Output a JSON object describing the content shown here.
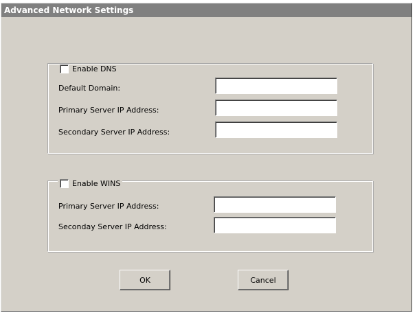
{
  "window": {
    "title": "Advanced Network Settings"
  },
  "dns": {
    "checkbox_label": "Enable DNS",
    "checked": false,
    "fields": [
      {
        "label": "Default Domain:",
        "value": ""
      },
      {
        "label": "Primary Server IP Address:",
        "value": ""
      },
      {
        "label": "Secondary Server IP Address:",
        "value": ""
      }
    ]
  },
  "wins": {
    "checkbox_label": "Enable WINS",
    "checked": false,
    "fields": [
      {
        "label": "Primary Server IP Address:",
        "value": ""
      },
      {
        "label": "Seconday Server IP Address:",
        "value": ""
      }
    ]
  },
  "buttons": {
    "ok": "OK",
    "cancel": "Cancel"
  }
}
